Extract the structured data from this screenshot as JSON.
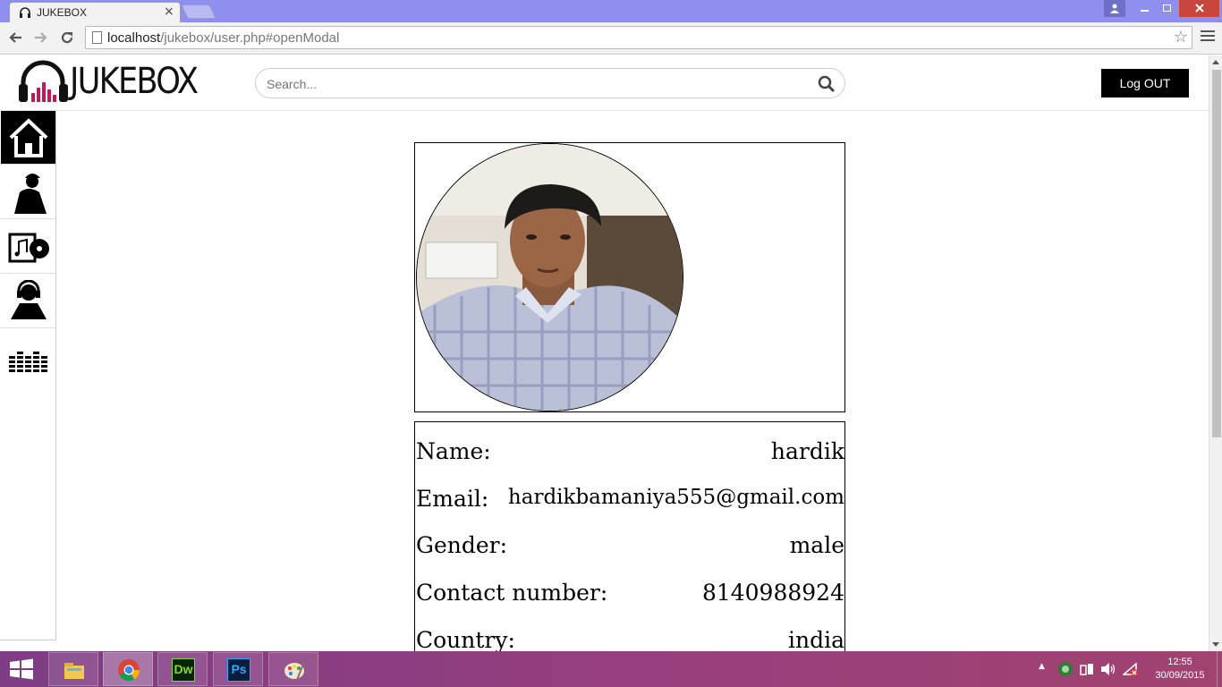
{
  "browser": {
    "tab_title": "JUKEBOX",
    "tab_close": "×",
    "url_host": "localhost",
    "url_path": "/jukebox/user.php#openModal"
  },
  "header": {
    "logo_text": "JUKEBOX",
    "search_placeholder": "Search...",
    "logout_label": "Log OUT"
  },
  "sidebar": {
    "items": [
      {
        "icon": "home-icon",
        "active": true
      },
      {
        "icon": "artist-icon",
        "active": false
      },
      {
        "icon": "album-icon",
        "active": false
      },
      {
        "icon": "dj-icon",
        "active": false
      },
      {
        "icon": "equalizer-icon",
        "active": false
      }
    ]
  },
  "profile": {
    "fields": [
      {
        "label": "Name:",
        "value": "hardik"
      },
      {
        "label": "Email:",
        "value": "hardikbamaniya555@gmail.com"
      },
      {
        "label": "Gender:",
        "value": "male"
      },
      {
        "label": "Contact number:",
        "value": "8140988924"
      },
      {
        "label": "Country:",
        "value": "india"
      }
    ]
  },
  "taskbar": {
    "apps": [
      "file-explorer-icon",
      "chrome-icon",
      "dreamweaver-icon",
      "photoshop-icon",
      "paint-icon"
    ],
    "dw_label": "Dw",
    "ps_label": "Ps",
    "time": "12:55",
    "date": "30/09/2015"
  }
}
